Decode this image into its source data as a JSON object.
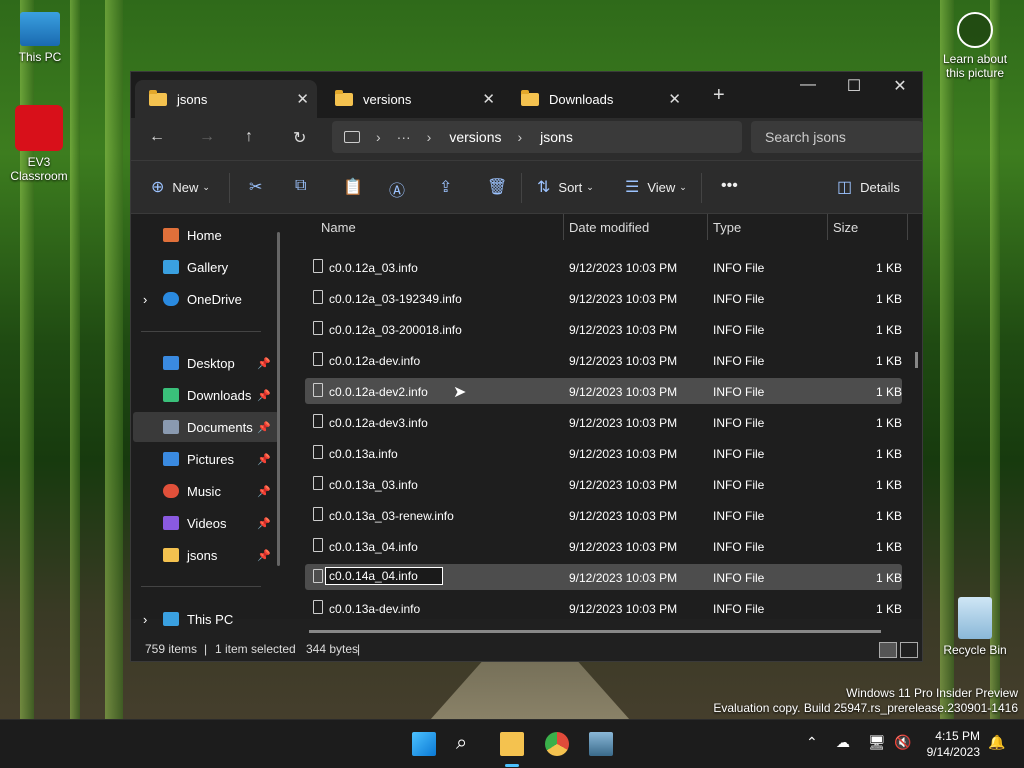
{
  "desktop": {
    "icons": [
      {
        "label": "This PC"
      },
      {
        "label": "EV3 Classroom"
      },
      {
        "label": "Recycle Bin"
      },
      {
        "label": "Learn about this picture"
      }
    ],
    "watermark_line1": "Windows 11 Pro Insider Preview",
    "watermark_line2": "Evaluation copy. Build 25947.rs_prerelease.230901-1416"
  },
  "tabs": [
    {
      "label": "jsons",
      "active": true
    },
    {
      "label": "versions",
      "active": false
    },
    {
      "label": "Downloads",
      "active": false
    }
  ],
  "address": {
    "crumb1": "versions",
    "crumb2": "jsons",
    "search_placeholder": "Search jsons"
  },
  "toolbar": {
    "new_label": "New",
    "sort_label": "Sort",
    "view_label": "View",
    "details_label": "Details"
  },
  "sidebar": {
    "items": [
      {
        "label": "Home",
        "color": "#e0703a"
      },
      {
        "label": "Gallery",
        "color": "#3aa0e0"
      },
      {
        "label": "OneDrive",
        "color": "#2a8ae0"
      },
      {
        "label": "Desktop",
        "color": "#3a8ae0"
      },
      {
        "label": "Downloads",
        "color": "#3ac07a"
      },
      {
        "label": "Documents",
        "color": "#8a9ab0"
      },
      {
        "label": "Pictures",
        "color": "#3a8ae0"
      },
      {
        "label": "Music",
        "color": "#e0503a"
      },
      {
        "label": "Videos",
        "color": "#8a5ae0"
      },
      {
        "label": "jsons",
        "color": "#f4c24f"
      },
      {
        "label": "This PC",
        "color": "#3aa0e0"
      }
    ]
  },
  "columns": {
    "name": "Name",
    "date": "Date modified",
    "type": "Type",
    "size": "Size"
  },
  "files": [
    {
      "name": "c0.0.12a_03.info",
      "date": "9/12/2023 10:03 PM",
      "type": "INFO File",
      "size": "1 KB"
    },
    {
      "name": "c0.0.12a_03-192349.info",
      "date": "9/12/2023 10:03 PM",
      "type": "INFO File",
      "size": "1 KB"
    },
    {
      "name": "c0.0.12a_03-200018.info",
      "date": "9/12/2023 10:03 PM",
      "type": "INFO File",
      "size": "1 KB"
    },
    {
      "name": "c0.0.12a-dev.info",
      "date": "9/12/2023 10:03 PM",
      "type": "INFO File",
      "size": "1 KB"
    },
    {
      "name": "c0.0.12a-dev2.info",
      "date": "9/12/2023 10:03 PM",
      "type": "INFO File",
      "size": "1 KB"
    },
    {
      "name": "c0.0.12a-dev3.info",
      "date": "9/12/2023 10:03 PM",
      "type": "INFO File",
      "size": "1 KB"
    },
    {
      "name": "c0.0.13a.info",
      "date": "9/12/2023 10:03 PM",
      "type": "INFO File",
      "size": "1 KB"
    },
    {
      "name": "c0.0.13a_03.info",
      "date": "9/12/2023 10:03 PM",
      "type": "INFO File",
      "size": "1 KB"
    },
    {
      "name": "c0.0.13a_03-renew.info",
      "date": "9/12/2023 10:03 PM",
      "type": "INFO File",
      "size": "1 KB"
    },
    {
      "name": "c0.0.13a_04.info",
      "date": "9/12/2023 10:03 PM",
      "type": "INFO File",
      "size": "1 KB"
    },
    {
      "name": "c0.0.14a_04.info",
      "date": "9/12/2023 10:03 PM",
      "type": "INFO File",
      "size": "1 KB"
    },
    {
      "name": "c0.0.13a-dev.info",
      "date": "9/12/2023 10:03 PM",
      "type": "INFO File",
      "size": "1 KB"
    }
  ],
  "rename_value": "c0.0.14a_04.info",
  "status": {
    "items": "759 items",
    "selected": "1 item selected",
    "bytes": "344 bytes"
  },
  "clock": {
    "time": "4:15 PM",
    "date": "9/14/2023"
  }
}
